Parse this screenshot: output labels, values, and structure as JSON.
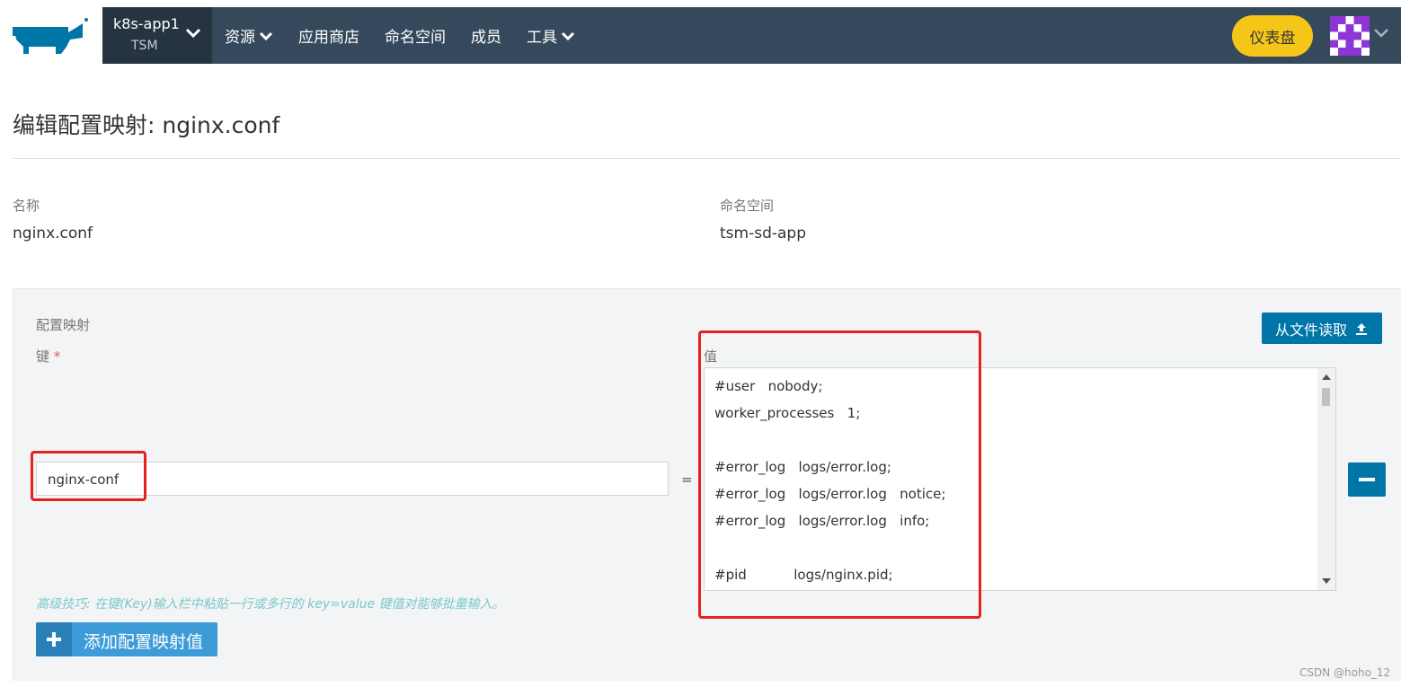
{
  "colors": {
    "nav_bg": "#36495c",
    "cluster_bg": "#263442",
    "accent_blue": "#0075a8",
    "dashboard_yellow": "#f5c518",
    "highlight_red": "#e5221c",
    "tip_text": "#7cc8c9"
  },
  "nav": {
    "logo_icon": "rancher-logo-icon",
    "cluster": {
      "name": "k8s-app1",
      "project": "TSM"
    },
    "menu": [
      {
        "label": "资源",
        "dropdown": true
      },
      {
        "label": "应用商店",
        "dropdown": false
      },
      {
        "label": "命名空间",
        "dropdown": false
      },
      {
        "label": "成员",
        "dropdown": false
      },
      {
        "label": "工具",
        "dropdown": true
      }
    ],
    "dashboard_label": "仪表盘",
    "avatar_icon": "user-avatar-icon"
  },
  "page": {
    "title": "编辑配置映射: nginx.conf",
    "name_label": "名称",
    "name_value": "nginx.conf",
    "namespace_label": "命名空间",
    "namespace_value": "tsm-sd-app"
  },
  "configmap": {
    "section_label": "配置映射",
    "key_label": "键",
    "required_mark": "*",
    "value_label": "值",
    "read_from_file_label": "从文件读取",
    "key_value": "nginx-conf",
    "equals": "=",
    "value_lines": [
      "#user   nobody;",
      "worker_processes   1;",
      "",
      "#error_log   logs/error.log;",
      "#error_log   logs/error.log   notice;",
      "#error_log   logs/error.log   info;",
      "",
      "#pid           logs/nginx.pid;"
    ],
    "tip": "高级技巧: 在键(Key)输入栏中粘贴一行或多行的 key=value 键值对能够批量输入。",
    "add_button_label": "添加配置映射值"
  },
  "watermark": "CSDN @hoho_12"
}
